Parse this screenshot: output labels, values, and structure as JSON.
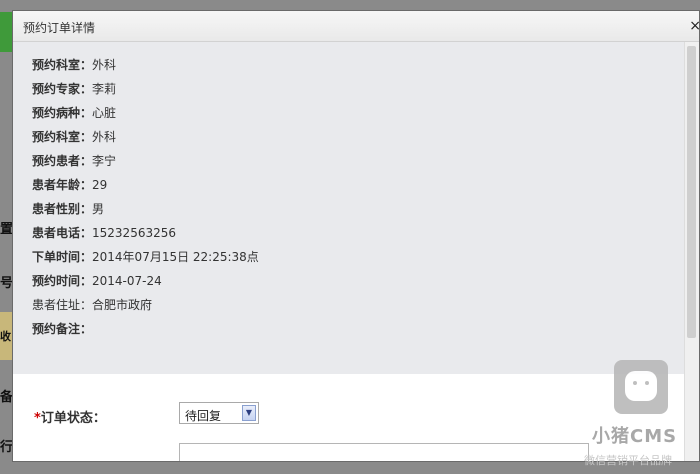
{
  "dialog": {
    "title": "预约订单详情",
    "close": "×"
  },
  "details": [
    {
      "label": "预约科室：",
      "value": "外科"
    },
    {
      "label": "预约专家：",
      "value": "李莉"
    },
    {
      "label": "预约病种：",
      "value": "心脏"
    },
    {
      "label": "预约科室：",
      "value": "外科"
    },
    {
      "label": "预约患者：",
      "value": "李宁"
    },
    {
      "label": "患者年龄：",
      "value": "29"
    },
    {
      "label": "患者性别：",
      "value": "男"
    },
    {
      "label": "患者电话：",
      "value": "15232563256"
    },
    {
      "label": "下单时间：",
      "value": "2014年07月15日 22:25:38点"
    },
    {
      "label": "预约时间：",
      "value": "2014-07-24"
    },
    {
      "label": "患者住址：",
      "value": "合肥市政府"
    },
    {
      "label": "预约备注：",
      "value": ""
    }
  ],
  "form": {
    "required_mark": "*",
    "status_label": "订单状态：",
    "status_selected": "待回复"
  },
  "background": {
    "fragments": [
      "置",
      "号",
      "收",
      "备",
      "行"
    ]
  },
  "watermark": {
    "text": "小猪CMS",
    "sub": "微信营销平台品牌"
  },
  "colors": {
    "panel": "#e9eaed",
    "required": "#cc0000",
    "overlay": "#7d7d7d"
  }
}
